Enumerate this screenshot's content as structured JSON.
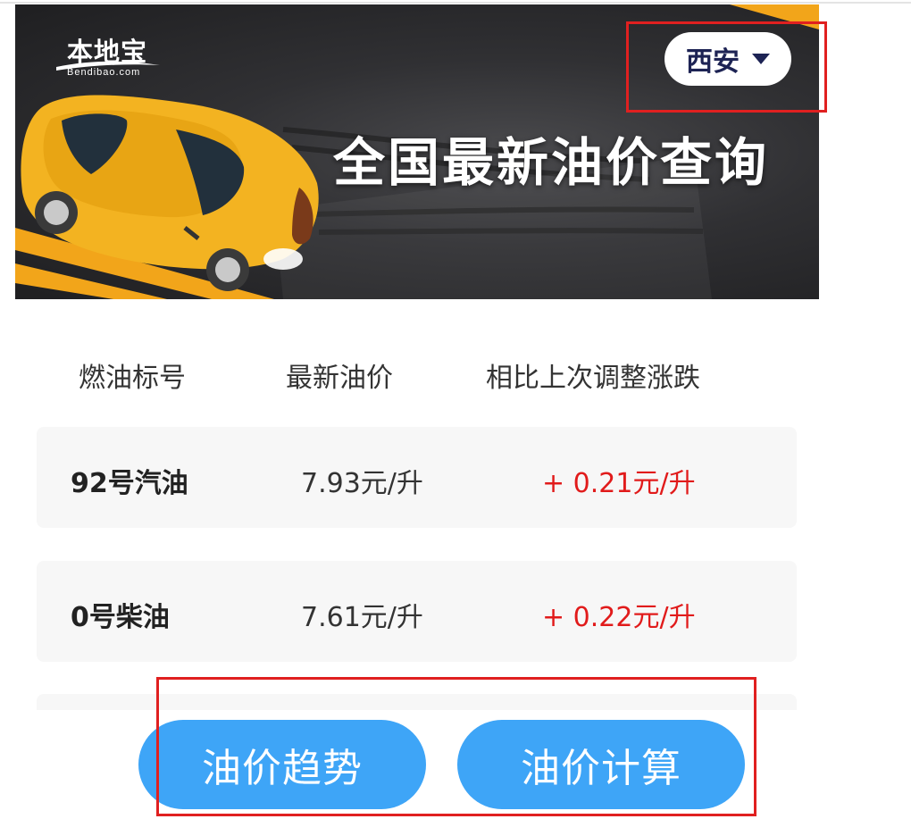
{
  "banner": {
    "logo_text": "本地宝",
    "logo_sub": "Bendibao.com",
    "title": "全国最新油价查询",
    "city": "西安",
    "colors": {
      "car": "#f3b321",
      "stripe": "#f2a51a",
      "background": "#2d2d30"
    }
  },
  "table": {
    "headers": [
      "燃油标号",
      "最新油价",
      "相比上次调整涨跌"
    ],
    "rows": [
      {
        "grade": "92号汽油",
        "price": "7.93元/升",
        "change": "+ 0.21元/升"
      },
      {
        "grade": "0号柴油",
        "price": "7.61元/升",
        "change": "+ 0.22元/升"
      }
    ]
  },
  "actions": {
    "trend_label": "油价趋势",
    "calc_label": "油价计算"
  },
  "colors": {
    "accent": "#3ea5f7",
    "increase": "#e11b1b",
    "highlight": "#e02020",
    "city_text": "#1d2354"
  }
}
